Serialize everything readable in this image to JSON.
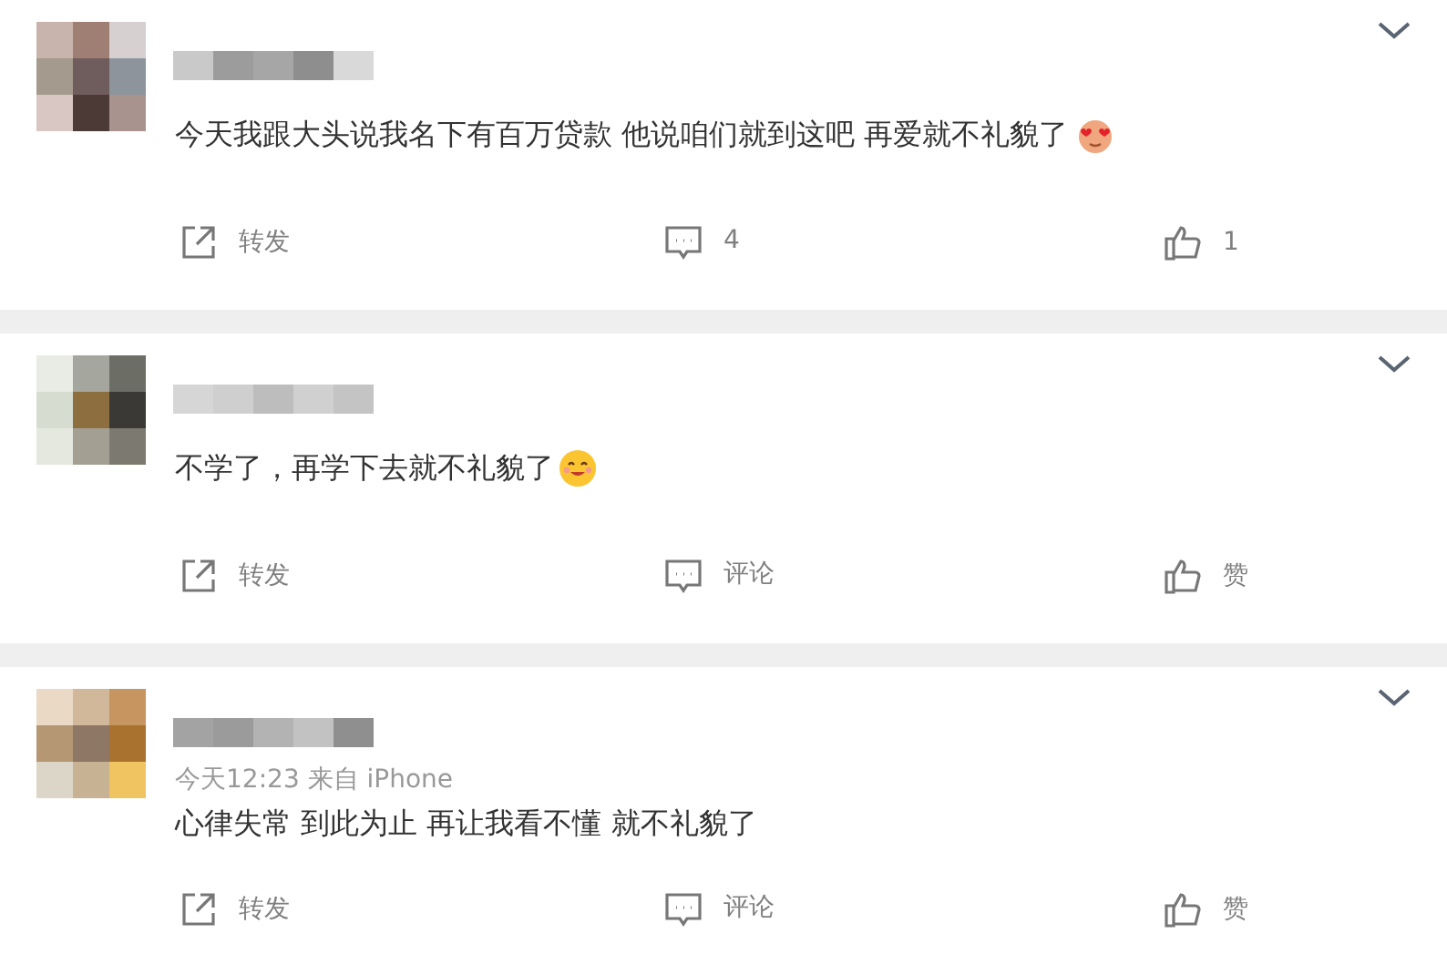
{
  "posts": [
    {
      "text": "今天我跟大头说我名下有百万贷款 他说咱们就到这吧 再爱就不礼貌了",
      "emoji": {
        "kind": "hearts"
      },
      "actions": [
        {
          "kind": "repost",
          "label": "转发"
        },
        {
          "kind": "comment",
          "label": "4"
        },
        {
          "kind": "like",
          "label": "1"
        }
      ]
    },
    {
      "text": "不学了，再学下去就不礼貌了",
      "emoji": {
        "kind": "smile"
      },
      "actions": [
        {
          "kind": "repost",
          "label": "转发"
        },
        {
          "kind": "comment",
          "label": "评论"
        },
        {
          "kind": "like",
          "label": "赞"
        }
      ]
    },
    {
      "meta": "今天12:23 来自 iPhone",
      "text": "心律失常 到此为止 再让我看不懂 就不礼貌了",
      "actions": [
        {
          "kind": "repost",
          "label": "转发"
        },
        {
          "kind": "comment",
          "label": "评论"
        },
        {
          "kind": "like",
          "label": "赞"
        }
      ]
    }
  ]
}
